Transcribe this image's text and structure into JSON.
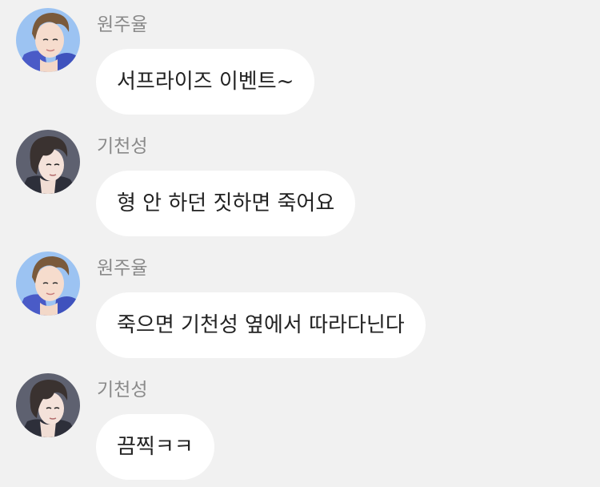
{
  "messages": [
    {
      "sender": "원주율",
      "avatar": "wonjuyul-avatar",
      "text": "서프라이즈 이벤트~"
    },
    {
      "sender": "기천성",
      "avatar": "gicheonseong-avatar",
      "text": "형 안 하던 짓하면 죽어요"
    },
    {
      "sender": "원주율",
      "avatar": "wonjuyul-avatar",
      "text": "죽으면 기천성 옆에서 따라다닌다"
    },
    {
      "sender": "기천성",
      "avatar": "gicheonseong-avatar",
      "text": "끔찍ㅋㅋ"
    }
  ],
  "colors": {
    "background": "#f1f1f1",
    "bubble": "#ffffff",
    "sender_text": "#8a8a8a",
    "message_text": "#222222"
  }
}
